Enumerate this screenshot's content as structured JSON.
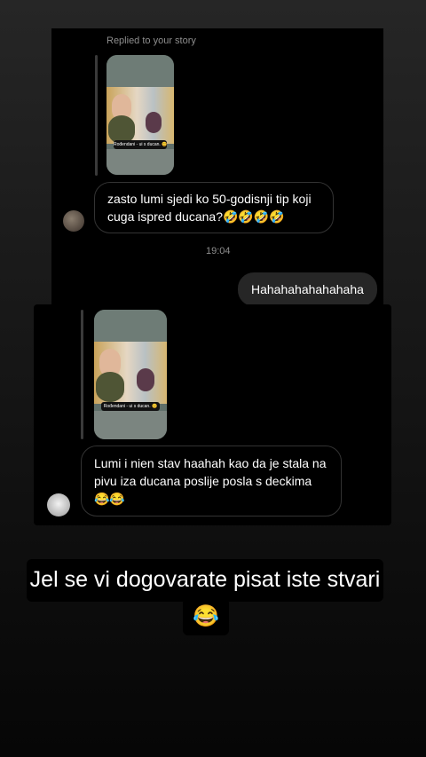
{
  "top_chat": {
    "replied_label": "Replied to your story",
    "story_caption": "Rođendani - ui s ducan. 😊",
    "message": "zasto lumi sjedi ko 50-godisnji tip koji cuga ispred ducana?🤣🤣🤣🤣",
    "timestamp": "19:04",
    "outgoing": "Hahahahahahahaha"
  },
  "bottom_chat": {
    "story_caption": "Rođendani - ui s ducan. 😊",
    "message": "Lumi i nien stav haahah kao da je stala na pivu iza ducana poslije posla s deckima 😂😂"
  },
  "overlay": {
    "text": "Jel se vi dogovarate pisat iste stvari",
    "emoji": "😂"
  },
  "colors": {
    "background_top": "#262626",
    "bubble_outgoing": "#262626",
    "meta_text": "#8e8e8e"
  }
}
